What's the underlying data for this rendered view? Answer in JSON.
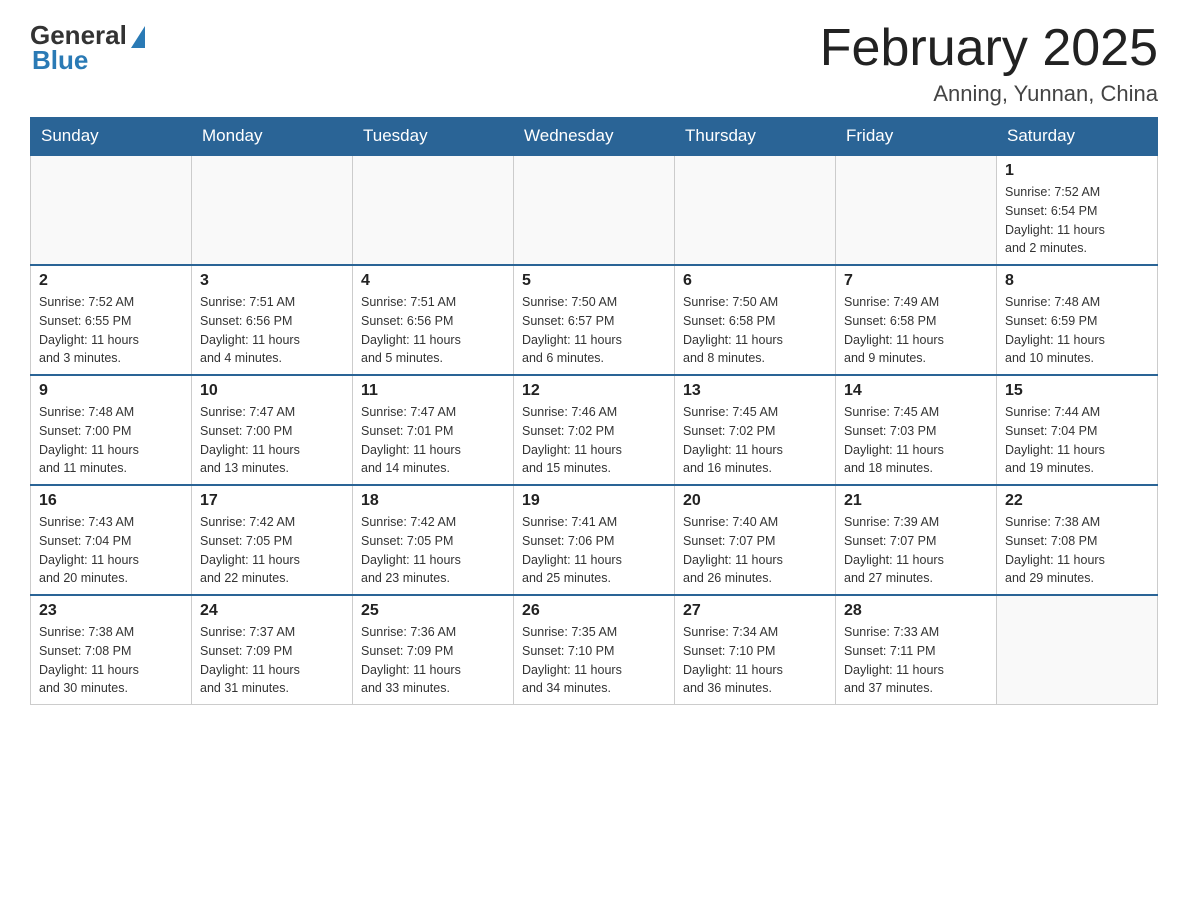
{
  "header": {
    "logo_general": "General",
    "logo_blue": "Blue",
    "month_title": "February 2025",
    "location": "Anning, Yunnan, China"
  },
  "weekdays": [
    "Sunday",
    "Monday",
    "Tuesday",
    "Wednesday",
    "Thursday",
    "Friday",
    "Saturday"
  ],
  "weeks": [
    [
      {
        "day": "",
        "info": ""
      },
      {
        "day": "",
        "info": ""
      },
      {
        "day": "",
        "info": ""
      },
      {
        "day": "",
        "info": ""
      },
      {
        "day": "",
        "info": ""
      },
      {
        "day": "",
        "info": ""
      },
      {
        "day": "1",
        "info": "Sunrise: 7:52 AM\nSunset: 6:54 PM\nDaylight: 11 hours\nand 2 minutes."
      }
    ],
    [
      {
        "day": "2",
        "info": "Sunrise: 7:52 AM\nSunset: 6:55 PM\nDaylight: 11 hours\nand 3 minutes."
      },
      {
        "day": "3",
        "info": "Sunrise: 7:51 AM\nSunset: 6:56 PM\nDaylight: 11 hours\nand 4 minutes."
      },
      {
        "day": "4",
        "info": "Sunrise: 7:51 AM\nSunset: 6:56 PM\nDaylight: 11 hours\nand 5 minutes."
      },
      {
        "day": "5",
        "info": "Sunrise: 7:50 AM\nSunset: 6:57 PM\nDaylight: 11 hours\nand 6 minutes."
      },
      {
        "day": "6",
        "info": "Sunrise: 7:50 AM\nSunset: 6:58 PM\nDaylight: 11 hours\nand 8 minutes."
      },
      {
        "day": "7",
        "info": "Sunrise: 7:49 AM\nSunset: 6:58 PM\nDaylight: 11 hours\nand 9 minutes."
      },
      {
        "day": "8",
        "info": "Sunrise: 7:48 AM\nSunset: 6:59 PM\nDaylight: 11 hours\nand 10 minutes."
      }
    ],
    [
      {
        "day": "9",
        "info": "Sunrise: 7:48 AM\nSunset: 7:00 PM\nDaylight: 11 hours\nand 11 minutes."
      },
      {
        "day": "10",
        "info": "Sunrise: 7:47 AM\nSunset: 7:00 PM\nDaylight: 11 hours\nand 13 minutes."
      },
      {
        "day": "11",
        "info": "Sunrise: 7:47 AM\nSunset: 7:01 PM\nDaylight: 11 hours\nand 14 minutes."
      },
      {
        "day": "12",
        "info": "Sunrise: 7:46 AM\nSunset: 7:02 PM\nDaylight: 11 hours\nand 15 minutes."
      },
      {
        "day": "13",
        "info": "Sunrise: 7:45 AM\nSunset: 7:02 PM\nDaylight: 11 hours\nand 16 minutes."
      },
      {
        "day": "14",
        "info": "Sunrise: 7:45 AM\nSunset: 7:03 PM\nDaylight: 11 hours\nand 18 minutes."
      },
      {
        "day": "15",
        "info": "Sunrise: 7:44 AM\nSunset: 7:04 PM\nDaylight: 11 hours\nand 19 minutes."
      }
    ],
    [
      {
        "day": "16",
        "info": "Sunrise: 7:43 AM\nSunset: 7:04 PM\nDaylight: 11 hours\nand 20 minutes."
      },
      {
        "day": "17",
        "info": "Sunrise: 7:42 AM\nSunset: 7:05 PM\nDaylight: 11 hours\nand 22 minutes."
      },
      {
        "day": "18",
        "info": "Sunrise: 7:42 AM\nSunset: 7:05 PM\nDaylight: 11 hours\nand 23 minutes."
      },
      {
        "day": "19",
        "info": "Sunrise: 7:41 AM\nSunset: 7:06 PM\nDaylight: 11 hours\nand 25 minutes."
      },
      {
        "day": "20",
        "info": "Sunrise: 7:40 AM\nSunset: 7:07 PM\nDaylight: 11 hours\nand 26 minutes."
      },
      {
        "day": "21",
        "info": "Sunrise: 7:39 AM\nSunset: 7:07 PM\nDaylight: 11 hours\nand 27 minutes."
      },
      {
        "day": "22",
        "info": "Sunrise: 7:38 AM\nSunset: 7:08 PM\nDaylight: 11 hours\nand 29 minutes."
      }
    ],
    [
      {
        "day": "23",
        "info": "Sunrise: 7:38 AM\nSunset: 7:08 PM\nDaylight: 11 hours\nand 30 minutes."
      },
      {
        "day": "24",
        "info": "Sunrise: 7:37 AM\nSunset: 7:09 PM\nDaylight: 11 hours\nand 31 minutes."
      },
      {
        "day": "25",
        "info": "Sunrise: 7:36 AM\nSunset: 7:09 PM\nDaylight: 11 hours\nand 33 minutes."
      },
      {
        "day": "26",
        "info": "Sunrise: 7:35 AM\nSunset: 7:10 PM\nDaylight: 11 hours\nand 34 minutes."
      },
      {
        "day": "27",
        "info": "Sunrise: 7:34 AM\nSunset: 7:10 PM\nDaylight: 11 hours\nand 36 minutes."
      },
      {
        "day": "28",
        "info": "Sunrise: 7:33 AM\nSunset: 7:11 PM\nDaylight: 11 hours\nand 37 minutes."
      },
      {
        "day": "",
        "info": ""
      }
    ]
  ]
}
